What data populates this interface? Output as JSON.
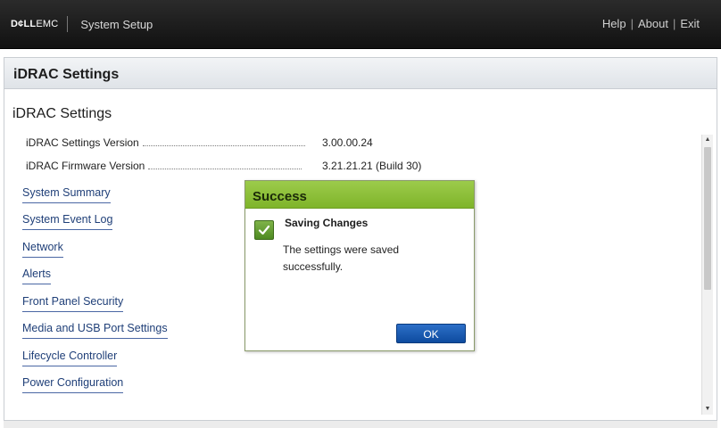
{
  "topbar": {
    "brand_bold": "D¢LL",
    "brand_thin": "EMC",
    "title": "System Setup",
    "links": [
      "Help",
      "About",
      "Exit"
    ]
  },
  "frame": {
    "header_title": "iDRAC Settings",
    "page_title": "iDRAC Settings"
  },
  "info": [
    {
      "label": "iDRAC Settings Version",
      "value": "3.00.00.24"
    },
    {
      "label": "iDRAC Firmware Version",
      "value": "3.21.21.21 (Build 30)"
    }
  ],
  "nav": [
    {
      "label": "System Summary"
    },
    {
      "label": "System Event Log"
    },
    {
      "label": "Network"
    },
    {
      "label": "Alerts"
    },
    {
      "label": "Front Panel Security"
    },
    {
      "label": "Media and USB Port Settings"
    },
    {
      "label": "Lifecycle Controller"
    },
    {
      "label": "Power Configuration"
    }
  ],
  "dialog": {
    "title": "Success",
    "heading": "Saving Changes",
    "message": "The settings were saved successfully.",
    "ok_label": "OK"
  },
  "colors": {
    "dialog_header": "#8fc23d",
    "ok_button": "#1b5bb3",
    "link": "#1f3f78"
  }
}
